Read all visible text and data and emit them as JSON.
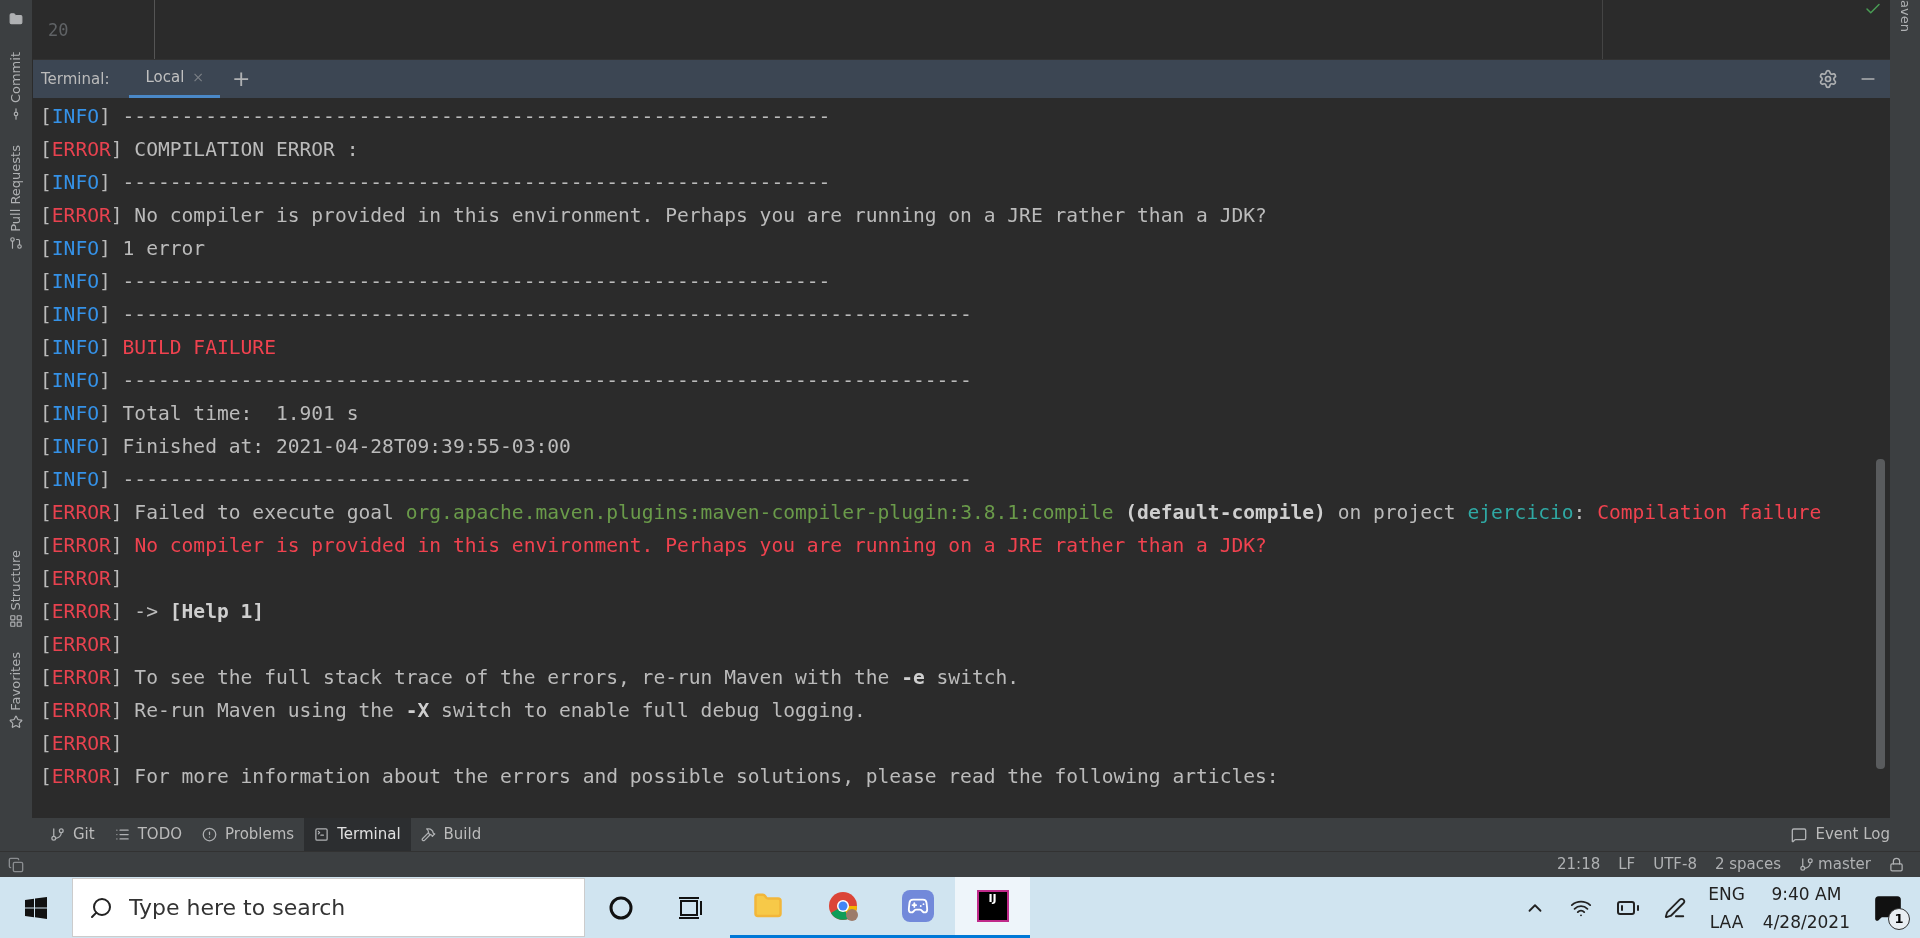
{
  "editor": {
    "line_number": "20"
  },
  "side_stripe_left": [
    {
      "label": "Commit",
      "kind": "commit"
    },
    {
      "label": "Pull Requests",
      "kind": "pull"
    },
    {
      "label": "Structure",
      "kind": "structure"
    },
    {
      "label": "Favorites",
      "kind": "favorites"
    }
  ],
  "side_stripe_right": {
    "label": "aven"
  },
  "terminal": {
    "title": "Terminal:",
    "tabs": [
      {
        "label": "Local",
        "selected": true,
        "close": "×"
      }
    ],
    "add": "+",
    "lines": [
      [
        {
          "text": "[",
          "kind": "plain"
        },
        {
          "text": "INFO",
          "kind": "info"
        },
        {
          "text": "] ------------------------------------------------------------",
          "kind": "plain"
        }
      ],
      [
        {
          "text": "[",
          "kind": "plain"
        },
        {
          "text": "ERROR",
          "kind": "error"
        },
        {
          "text": "] COMPILATION ERROR :",
          "kind": "plain"
        }
      ],
      [
        {
          "text": "[",
          "kind": "plain"
        },
        {
          "text": "INFO",
          "kind": "info"
        },
        {
          "text": "] ------------------------------------------------------------",
          "kind": "plain"
        }
      ],
      [
        {
          "text": "[",
          "kind": "plain"
        },
        {
          "text": "ERROR",
          "kind": "error"
        },
        {
          "text": "] No compiler is provided in this environment. Perhaps you are running on a JRE rather than a JDK?",
          "kind": "plain"
        }
      ],
      [
        {
          "text": "[",
          "kind": "plain"
        },
        {
          "text": "INFO",
          "kind": "info"
        },
        {
          "text": "] 1 error",
          "kind": "plain"
        }
      ],
      [
        {
          "text": "[",
          "kind": "plain"
        },
        {
          "text": "INFO",
          "kind": "info"
        },
        {
          "text": "] ------------------------------------------------------------",
          "kind": "plain"
        }
      ],
      [
        {
          "text": "[",
          "kind": "plain"
        },
        {
          "text": "INFO",
          "kind": "info"
        },
        {
          "text": "] ------------------------------------------------------------------------",
          "kind": "plain"
        }
      ],
      [
        {
          "text": "[",
          "kind": "plain"
        },
        {
          "text": "INFO",
          "kind": "info"
        },
        {
          "text": "] ",
          "kind": "plain"
        },
        {
          "text": "BUILD FAILURE",
          "kind": "failure"
        }
      ],
      [
        {
          "text": "[",
          "kind": "plain"
        },
        {
          "text": "INFO",
          "kind": "info"
        },
        {
          "text": "] ------------------------------------------------------------------------",
          "kind": "plain"
        }
      ],
      [
        {
          "text": "[",
          "kind": "plain"
        },
        {
          "text": "INFO",
          "kind": "info"
        },
        {
          "text": "] Total time:  1.901 s",
          "kind": "plain"
        }
      ],
      [
        {
          "text": "[",
          "kind": "plain"
        },
        {
          "text": "INFO",
          "kind": "info"
        },
        {
          "text": "] Finished at: 2021-04-28T09:39:55-03:00",
          "kind": "plain"
        }
      ],
      [
        {
          "text": "[",
          "kind": "plain"
        },
        {
          "text": "INFO",
          "kind": "info"
        },
        {
          "text": "] ------------------------------------------------------------------------",
          "kind": "plain"
        }
      ],
      [
        {
          "text": "[",
          "kind": "plain"
        },
        {
          "text": "ERROR",
          "kind": "error"
        },
        {
          "text": "] Failed to execute goal ",
          "kind": "plain"
        },
        {
          "text": "org.apache.maven.plugins:maven-compiler-plugin:3.8.1:compile",
          "kind": "goal"
        },
        {
          "text": " (default-compile)",
          "kind": "emphasis"
        },
        {
          "text": " on project ",
          "kind": "plain"
        },
        {
          "text": "ejercicio",
          "kind": "project"
        },
        {
          "text": ": ",
          "kind": "plain"
        },
        {
          "text": "Compilation failure",
          "kind": "failure"
        }
      ],
      [
        {
          "text": "[",
          "kind": "plain"
        },
        {
          "text": "ERROR",
          "kind": "error"
        },
        {
          "text": "] ",
          "kind": "plain"
        },
        {
          "text": "No compiler is provided in this environment. Perhaps you are running on a JRE rather than a JDK?",
          "kind": "failure"
        }
      ],
      [
        {
          "text": "[",
          "kind": "plain"
        },
        {
          "text": "ERROR",
          "kind": "error"
        },
        {
          "text": "]",
          "kind": "plain"
        }
      ],
      [
        {
          "text": "[",
          "kind": "plain"
        },
        {
          "text": "ERROR",
          "kind": "error"
        },
        {
          "text": "] -> ",
          "kind": "plain"
        },
        {
          "text": "[Help 1]",
          "kind": "emphasis"
        }
      ],
      [
        {
          "text": "[",
          "kind": "plain"
        },
        {
          "text": "ERROR",
          "kind": "error"
        },
        {
          "text": "]",
          "kind": "plain"
        }
      ],
      [
        {
          "text": "[",
          "kind": "plain"
        },
        {
          "text": "ERROR",
          "kind": "error"
        },
        {
          "text": "] To see the full stack trace of the errors, re-run Maven with the ",
          "kind": "plain"
        },
        {
          "text": "-e",
          "kind": "emphasis"
        },
        {
          "text": " switch.",
          "kind": "plain"
        }
      ],
      [
        {
          "text": "[",
          "kind": "plain"
        },
        {
          "text": "ERROR",
          "kind": "error"
        },
        {
          "text": "] Re-run Maven using the ",
          "kind": "plain"
        },
        {
          "text": "-X",
          "kind": "emphasis"
        },
        {
          "text": " switch to enable full debug logging.",
          "kind": "plain"
        }
      ],
      [
        {
          "text": "[",
          "kind": "plain"
        },
        {
          "text": "ERROR",
          "kind": "error"
        },
        {
          "text": "]",
          "kind": "plain"
        }
      ],
      [
        {
          "text": "[",
          "kind": "plain"
        },
        {
          "text": "ERROR",
          "kind": "error"
        },
        {
          "text": "] For more information about the errors and possible solutions, please read the following articles:",
          "kind": "plain"
        }
      ]
    ]
  },
  "tool_windows": [
    {
      "label": "Git",
      "kind": "git",
      "selected": false
    },
    {
      "label": "TODO",
      "kind": "todo",
      "selected": false
    },
    {
      "label": "Problems",
      "kind": "problems",
      "selected": false
    },
    {
      "label": "Terminal",
      "kind": "terminal",
      "selected": true
    },
    {
      "label": "Build",
      "kind": "build",
      "selected": false
    }
  ],
  "event_log": "Event Log",
  "status_bar": {
    "items": [
      "21:18",
      "LF",
      "UTF-8",
      "2 spaces"
    ],
    "branch": "master"
  },
  "taskbar": {
    "search": {
      "placeholder": "Type here to search"
    },
    "apps": [
      {
        "kind": "explorer",
        "active": false
      },
      {
        "kind": "chrome",
        "active": false
      },
      {
        "kind": "discord",
        "active": false
      },
      {
        "kind": "intellij",
        "active": true,
        "label": "IJ"
      }
    ],
    "language": [
      "ENG",
      "LAA"
    ],
    "time": "9:40 AM",
    "date": "4/28/2021",
    "notifications": "1"
  }
}
